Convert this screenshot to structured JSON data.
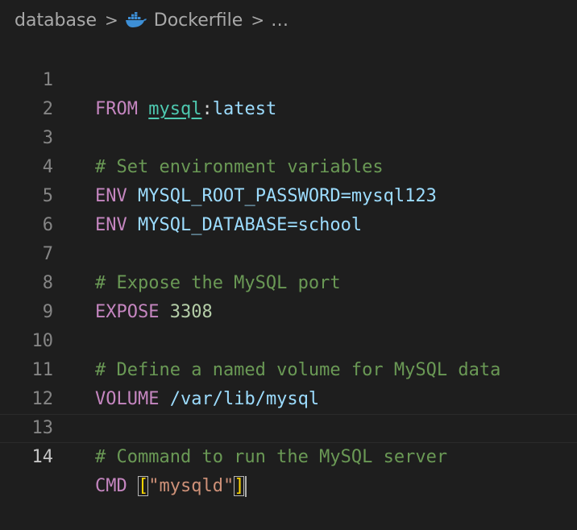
{
  "breadcrumb": {
    "folder": "database",
    "separator": ">",
    "file": "Dockerfile",
    "ellipsis": "…",
    "file_icon": "docker-whale-icon"
  },
  "editor": {
    "current_line": 14,
    "lines": [
      {
        "number": "1",
        "from": "FROM",
        "image": "mysql",
        "colon": ":",
        "tag": "latest"
      },
      {
        "number": "2"
      },
      {
        "number": "3",
        "comment": "# Set environment variables"
      },
      {
        "number": "4",
        "keyword": "ENV",
        "value": "MYSQL_ROOT_PASSWORD=mysql123"
      },
      {
        "number": "5",
        "keyword": "ENV",
        "value": "MYSQL_DATABASE=school"
      },
      {
        "number": "6"
      },
      {
        "number": "7",
        "comment": "# Expose the MySQL port"
      },
      {
        "number": "8",
        "keyword": "EXPOSE",
        "value": "3308"
      },
      {
        "number": "9"
      },
      {
        "number": "10",
        "comment": "# Define a named volume for MySQL data"
      },
      {
        "number": "11",
        "keyword": "VOLUME",
        "value": "/var/lib/mysql"
      },
      {
        "number": "12"
      },
      {
        "number": "13",
        "comment": "# Command to run the MySQL server"
      },
      {
        "number": "14",
        "keyword": "CMD",
        "open": "[",
        "string": "\"mysqld\"",
        "close": "]"
      }
    ]
  },
  "colors": {
    "background": "#1e1e1e",
    "keyword": "#c586c0",
    "identifier": "#9cdcfe",
    "image": "#4ec9b0",
    "comment": "#6a9955",
    "number": "#b5cea8",
    "string": "#ce9178",
    "bracket": "#ffd700"
  }
}
